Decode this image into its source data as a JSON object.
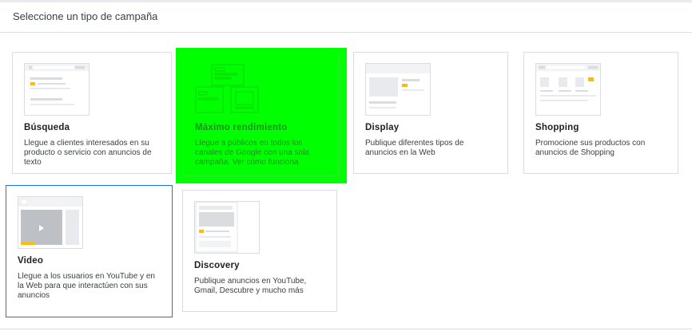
{
  "header": {
    "title": "Seleccione un tipo de campaña"
  },
  "cards": [
    {
      "title": "Búsqueda",
      "description": "Llegue a clientes interesados en su producto o servicio con anuncios de texto"
    },
    {
      "title": "Máximo rendimiento",
      "description": "Llegue a públicos en todos los canales de Google con una sola campaña.",
      "link": "Ver cómo funciona"
    },
    {
      "title": "Display",
      "description": "Publique diferentes tipos de anuncios en la Web"
    },
    {
      "title": "Shopping",
      "description": "Promocione sus productos con anuncios de Shopping"
    },
    {
      "title": "Video",
      "description": "Llegue a los usuarios en YouTube y en la Web para que interactúen con sus anuncios"
    },
    {
      "title": "Discovery",
      "description": "Publique anuncios en YouTube, Gmail, Descubre y mucho más"
    }
  ],
  "colors": {
    "accent_yellow": "#fbbc04",
    "selected_border": "#1a73e8",
    "highlight": "#00ff00"
  }
}
